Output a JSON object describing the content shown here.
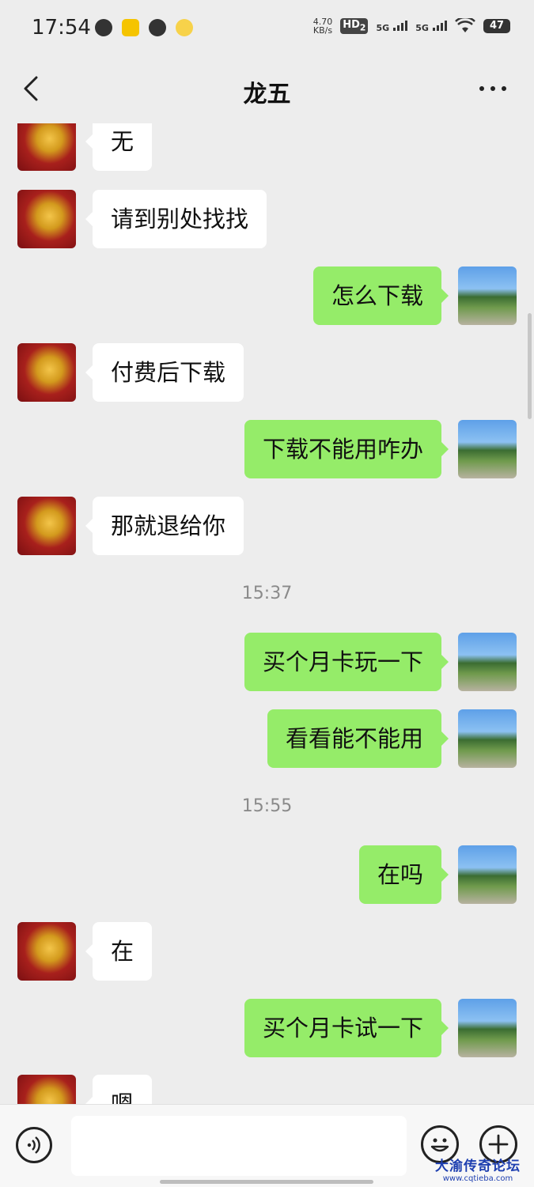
{
  "status_bar": {
    "time": "17:54",
    "net_speed": "4.70",
    "net_speed_unit": "KB/s",
    "hd_badge": "HD",
    "hd_sub": "2",
    "signal1": "5G",
    "signal2": "5G",
    "battery": "47"
  },
  "header": {
    "title": "龙五"
  },
  "messages": [
    {
      "side": "in",
      "text": "无"
    },
    {
      "side": "in",
      "text": "请到别处找找"
    },
    {
      "side": "out",
      "text": "怎么下载"
    },
    {
      "side": "in",
      "text": "付费后下载"
    },
    {
      "side": "out",
      "text": "下载不能用咋办"
    },
    {
      "side": "in",
      "text": "那就退给你"
    },
    {
      "side": "out",
      "text": "买个月卡玩一下"
    },
    {
      "side": "out",
      "text": "看看能不能用"
    },
    {
      "side": "out",
      "text": "在吗"
    },
    {
      "side": "in",
      "text": "在"
    },
    {
      "side": "out",
      "text": "买个月卡试一下"
    },
    {
      "side": "in",
      "text": "嗯"
    }
  ],
  "timestamps": [
    "15:37",
    "15:55"
  ],
  "input_bar": {
    "voice_icon": "voice-icon",
    "emoji_icon": "emoji-icon",
    "plus_icon": "plus-icon",
    "placeholder": ""
  },
  "watermark": {
    "title": "大渝传奇论坛",
    "url": "www.cqtieba.com"
  },
  "colors": {
    "background": "#ededed",
    "outgoing_bubble": "#95ec69",
    "incoming_bubble": "#ffffff",
    "watermark": "#1e3fb0"
  }
}
